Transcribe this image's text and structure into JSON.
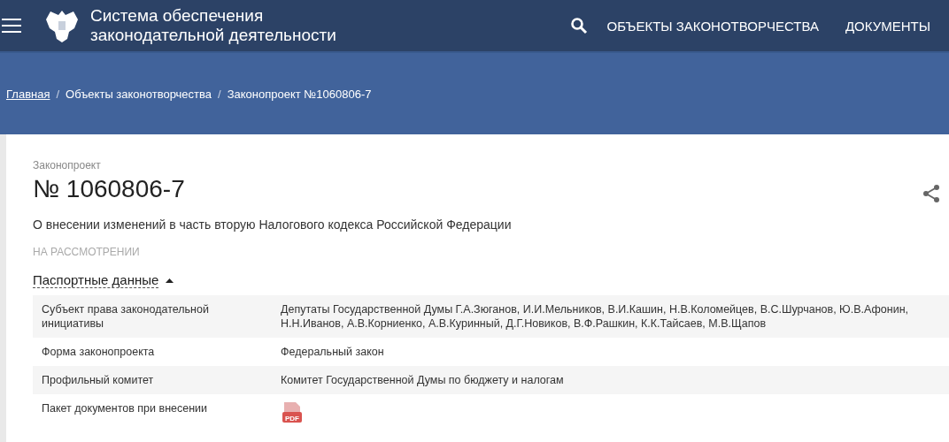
{
  "header": {
    "title_line_1": "Система обеспечения",
    "title_line_2": "законодательной деятельности",
    "nav": [
      "ОБЪЕКТЫ ЗАКОНОТВОРЧЕСТВА",
      "ДОКУМЕНТЫ"
    ]
  },
  "breadcrumbs": [
    {
      "label": "Главная",
      "kind": "link"
    },
    {
      "label": "/",
      "kind": "separator"
    },
    {
      "label": "Объекты законотворчества",
      "kind": "text"
    },
    {
      "label": "/",
      "kind": "separator"
    },
    {
      "label": "Законопроект №1060806-7",
      "kind": "text"
    }
  ],
  "bill": {
    "type_label": "Законопроект",
    "number": "№ 1060806-7",
    "title": "О внесении изменений в часть вторую Налогового кодекса Российской Федерации",
    "status": "НА РАССМОТРЕНИИ"
  },
  "passport": {
    "heading": "Паспортные данные",
    "expanded": true,
    "rows": [
      {
        "label": "Субъект права законодательной инициативы",
        "value": "Депутаты Государственной Думы Г.А.Зюганов, И.И.Мельников, В.И.Кашин, Н.В.Коломейцев, В.С.Шурчанов, Ю.В.Афонин, Н.Н.Иванов, А.В.Корниенко, А.В.Куринный, Д.Г.Новиков, В.Ф.Рашкин, К.К.Тайсаев, М.В.Щапов",
        "kind": "text"
      },
      {
        "label": "Форма законопроекта",
        "value": "Федеральный закон",
        "kind": "text"
      },
      {
        "label": "Профильный комитет",
        "value": "Комитет Государственной Думы по бюджету и налогам",
        "kind": "text"
      },
      {
        "label": "Пакет документов при внесении",
        "value": "PDF",
        "kind": "pdf"
      }
    ]
  }
}
